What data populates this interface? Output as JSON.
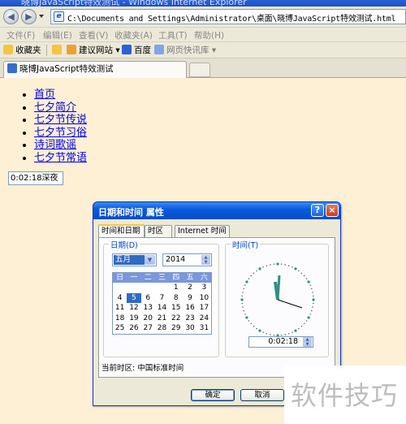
{
  "browser": {
    "window_title": "晓博JavaScript特效测试 - Windows Internet Explorer",
    "address": "C:\\Documents and Settings\\Administrator\\桌面\\晓博JavaScript特效测试.html",
    "menu": [
      "文件(F)",
      "编辑(E)",
      "查看(V)",
      "收藏夹(A)",
      "工具(T)",
      "帮助(H)"
    ],
    "favorites": {
      "label": "收藏夹",
      "links": [
        "建议网站 ▾",
        "百度",
        "网页快讯库 ▾"
      ]
    },
    "tab_title": "晓博JavaScript特效测试"
  },
  "page": {
    "links": [
      "首页",
      "七夕简介",
      "七夕节传说",
      "七夕节习俗",
      "诗词歌谣",
      "七夕节常语"
    ],
    "time_field": "0:02:18深夜"
  },
  "dialog": {
    "title": "日期和时间 属性",
    "help": "?",
    "close": "×",
    "tabs": [
      "时间和日期",
      "时区",
      "Internet 时间"
    ],
    "date_group": "日期(D)",
    "time_group": "时间(T)",
    "month": "五月",
    "year": "2014",
    "weekdays": [
      "日",
      "一",
      "二",
      "三",
      "四",
      "五",
      "六"
    ],
    "calendar_rows": [
      [
        "",
        "",
        "",
        "",
        "1",
        "2",
        "3"
      ],
      [
        "4",
        "5",
        "6",
        "7",
        "8",
        "9",
        "10"
      ],
      [
        "11",
        "12",
        "13",
        "14",
        "15",
        "16",
        "17"
      ],
      [
        "18",
        "19",
        "20",
        "21",
        "22",
        "23",
        "24"
      ],
      [
        "25",
        "26",
        "27",
        "28",
        "29",
        "30",
        "31"
      ]
    ],
    "selected_day": "5",
    "time": "0:02:18",
    "timezone": "当前时区:  中国标准时间",
    "ok": "确定",
    "cancel": "取消",
    "selection_color": "#316ac5"
  },
  "watermark": "软件技巧"
}
